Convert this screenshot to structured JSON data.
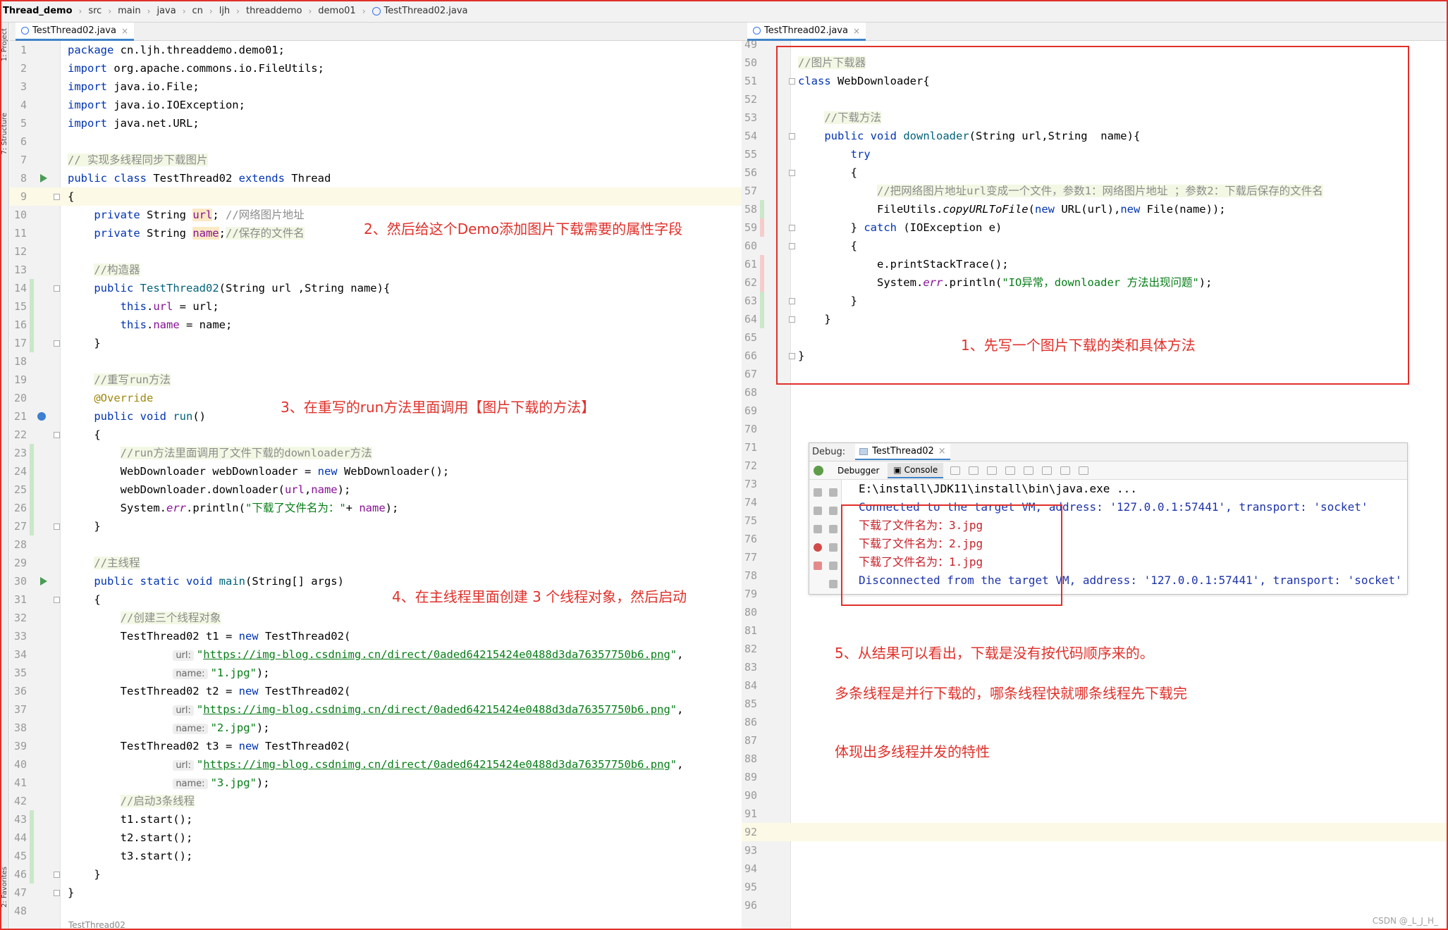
{
  "breadcrumb": [
    "Thread_demo",
    "src",
    "main",
    "java",
    "cn",
    "ljh",
    "threaddemo",
    "demo01",
    "TestThread02.java"
  ],
  "tool_window_labels": [
    "1: Project",
    "7: Structure",
    "2: Favorites"
  ],
  "left_tab": {
    "label": "TestThread02.java",
    "close": "×"
  },
  "right_tab": {
    "label": "TestThread02.java",
    "close": "×"
  },
  "bottom_file_label": "TestThread02",
  "left_lines": [
    {
      "n": "1",
      "html": "<span class=\"kw\">package</span> cn.ljh.threaddemo.demo01;"
    },
    {
      "n": "2",
      "html": "<span class=\"kw\">import</span> org.apache.commons.io.FileUtils;"
    },
    {
      "n": "3",
      "html": "<span class=\"kw\">import</span> java.io.File;"
    },
    {
      "n": "4",
      "html": "<span class=\"kw\">import</span> java.io.IOException;"
    },
    {
      "n": "5",
      "html": "<span class=\"kw\">import</span> java.net.URL;"
    },
    {
      "n": "6",
      "html": ""
    },
    {
      "n": "7",
      "html": "<span class=\"cmh\">// 实现多线程同步下载图片</span>"
    },
    {
      "n": "8",
      "html": "<span class=\"kw\">public class</span> TestThread02 <span class=\"kw\">extends</span> Thread"
    },
    {
      "n": "9",
      "html": "{"
    },
    {
      "n": "10",
      "html": "    <span class=\"kw\">private</span> String <span class=\"fd hl\">url</span>; <span class=\"cm\">//网络图片地址</span>"
    },
    {
      "n": "11",
      "html": "    <span class=\"kw\">private</span> String <span class=\"fd hl\">name</span>;<span class=\"cmh\">//保存的文件名</span>"
    },
    {
      "n": "12",
      "html": ""
    },
    {
      "n": "13",
      "html": "    <span class=\"cmh\">//构造器</span>"
    },
    {
      "n": "14",
      "html": "    <span class=\"kw\">public</span> <span class=\"mt\">TestThread02</span>(String url ,String name){"
    },
    {
      "n": "15",
      "html": "        <span class=\"kw\">this</span>.<span class=\"fd\">url</span> = url;"
    },
    {
      "n": "16",
      "html": "        <span class=\"kw\">this</span>.<span class=\"fd\">name</span> = name;"
    },
    {
      "n": "17",
      "html": "    }"
    },
    {
      "n": "18",
      "html": ""
    },
    {
      "n": "19",
      "html": "    <span class=\"cmh\">//重写run方法</span>"
    },
    {
      "n": "20",
      "html": "    <span class=\"ann\">@Override</span>"
    },
    {
      "n": "21",
      "html": "    <span class=\"kw\">public void</span> <span class=\"mt\">run</span>()"
    },
    {
      "n": "22",
      "html": "    {"
    },
    {
      "n": "23",
      "html": "        <span class=\"cmh\">//run方法里面调用了文件下载的downloader方法</span>"
    },
    {
      "n": "24",
      "html": "        WebDownloader webDownloader = <span class=\"kw\">new</span> WebDownloader();"
    },
    {
      "n": "25",
      "html": "        webDownloader.downloader(<span class=\"fd\">url</span>,<span class=\"fd\">name</span>);"
    },
    {
      "n": "26",
      "html": "        System.<span class=\"fd it\">err</span>.println(<span class=\"st\">\"下载了文件名为：\"</span>+ <span class=\"fd\">name</span>);"
    },
    {
      "n": "27",
      "html": "    }"
    },
    {
      "n": "28",
      "html": ""
    },
    {
      "n": "29",
      "html": "    <span class=\"cmh\">//主线程</span>"
    },
    {
      "n": "30",
      "html": "    <span class=\"kw\">public static void</span> <span class=\"mt\">main</span>(String[] args)"
    },
    {
      "n": "31",
      "html": "    {"
    },
    {
      "n": "32",
      "html": "        <span class=\"cmh\">//创建三个线程对象</span>"
    },
    {
      "n": "33",
      "html": "        TestThread02 t1 = <span class=\"kw\">new</span> TestThread02("
    },
    {
      "n": "34",
      "html": "                <span class=\"hint\">url:</span><span class=\"st\">\"<span class=\"url\">https://img-blog.csdnimg.cn/direct/0aded64215424e0488d3da76357750b6.png</span>\"</span>,"
    },
    {
      "n": "35",
      "html": "                <span class=\"hint\">name:</span><span class=\"st\">\"1.jpg\"</span>);"
    },
    {
      "n": "36",
      "html": "        TestThread02 t2 = <span class=\"kw\">new</span> TestThread02("
    },
    {
      "n": "37",
      "html": "                <span class=\"hint\">url:</span><span class=\"st\">\"<span class=\"url\">https://img-blog.csdnimg.cn/direct/0aded64215424e0488d3da76357750b6.png</span>\"</span>,"
    },
    {
      "n": "38",
      "html": "                <span class=\"hint\">name:</span><span class=\"st\">\"2.jpg\"</span>);"
    },
    {
      "n": "39",
      "html": "        TestThread02 t3 = <span class=\"kw\">new</span> TestThread02("
    },
    {
      "n": "40",
      "html": "                <span class=\"hint\">url:</span><span class=\"st\">\"<span class=\"url\">https://img-blog.csdnimg.cn/direct/0aded64215424e0488d3da76357750b6.png</span>\"</span>,"
    },
    {
      "n": "41",
      "html": "                <span class=\"hint\">name:</span><span class=\"st\">\"3.jpg\"</span>);"
    },
    {
      "n": "42",
      "html": "        <span class=\"cmh\">//启动3条线程</span>"
    },
    {
      "n": "43",
      "html": "        t1.start();"
    },
    {
      "n": "44",
      "html": "        t2.start();"
    },
    {
      "n": "45",
      "html": "        t3.start();"
    },
    {
      "n": "46",
      "html": "    }"
    },
    {
      "n": "47",
      "html": "}"
    },
    {
      "n": "48",
      "html": ""
    }
  ],
  "right_lines": [
    {
      "n": "49",
      "html": ""
    },
    {
      "n": "50",
      "html": "<span class=\"cmh\">//图片下载器</span>"
    },
    {
      "n": "51",
      "html": "<span class=\"kw\">class</span> WebDownloader{"
    },
    {
      "n": "52",
      "html": ""
    },
    {
      "n": "53",
      "html": "    <span class=\"cmh\">//下载方法</span>"
    },
    {
      "n": "54",
      "html": "    <span class=\"kw\">public void</span> <span class=\"mt\">downloader</span>(String url,String  name){"
    },
    {
      "n": "55",
      "html": "        <span class=\"kw\">try</span>"
    },
    {
      "n": "56",
      "html": "        {"
    },
    {
      "n": "57",
      "html": "            <span class=\"cmh\">//把网络图片地址url变成一个文件，参数1：网络图片地址 ；参数2：下载后保存的文件名</span>"
    },
    {
      "n": "58",
      "html": "            FileUtils.<span class=\"it\">copyURLToFile</span>(<span class=\"kw\">new</span> URL(url),<span class=\"kw\">new</span> File(name));"
    },
    {
      "n": "59",
      "html": "        } <span class=\"kw\">catch</span> (IOException e)"
    },
    {
      "n": "60",
      "html": "        {"
    },
    {
      "n": "61",
      "html": "            e.printStackTrace();"
    },
    {
      "n": "62",
      "html": "            System.<span class=\"fd it\">err</span>.println(<span class=\"st\">\"IO异常，downloader 方法出现问题\"</span>);"
    },
    {
      "n": "63",
      "html": "        }"
    },
    {
      "n": "64",
      "html": "    }"
    },
    {
      "n": "65",
      "html": ""
    },
    {
      "n": "66",
      "html": "}"
    },
    {
      "n": "67",
      "html": ""
    },
    {
      "n": "68",
      "html": ""
    },
    {
      "n": "69",
      "html": ""
    },
    {
      "n": "70",
      "html": ""
    },
    {
      "n": "71",
      "html": ""
    },
    {
      "n": "72",
      "html": ""
    },
    {
      "n": "73",
      "html": ""
    },
    {
      "n": "74",
      "html": ""
    },
    {
      "n": "75",
      "html": ""
    },
    {
      "n": "76",
      "html": ""
    },
    {
      "n": "77",
      "html": ""
    },
    {
      "n": "78",
      "html": ""
    },
    {
      "n": "79",
      "html": ""
    },
    {
      "n": "80",
      "html": ""
    },
    {
      "n": "81",
      "html": ""
    },
    {
      "n": "82",
      "html": ""
    },
    {
      "n": "83",
      "html": ""
    },
    {
      "n": "84",
      "html": ""
    },
    {
      "n": "85",
      "html": ""
    },
    {
      "n": "86",
      "html": ""
    },
    {
      "n": "87",
      "html": ""
    },
    {
      "n": "88",
      "html": ""
    },
    {
      "n": "89",
      "html": ""
    },
    {
      "n": "90",
      "html": ""
    },
    {
      "n": "91",
      "html": ""
    },
    {
      "n": "92",
      "html": ""
    },
    {
      "n": "93",
      "html": ""
    },
    {
      "n": "94",
      "html": ""
    },
    {
      "n": "95",
      "html": ""
    },
    {
      "n": "96",
      "html": ""
    }
  ],
  "debug": {
    "label": "Debug:",
    "tab": "TestThread02",
    "tab_close": "×",
    "debugger_tab": "Debugger",
    "console_tab": "Console",
    "console_lines": [
      {
        "text": "E:\\install\\JDK11\\install\\bin\\java.exe ...",
        "color": "black"
      },
      {
        "text": "Connected to the target VM, address: '127.0.0.1:57441', transport: 'socket'",
        "color": "blue"
      },
      {
        "text": "下载了文件名为：3.jpg",
        "color": "red"
      },
      {
        "text": "下载了文件名为：2.jpg",
        "color": "red"
      },
      {
        "text": "下载了文件名为：1.jpg",
        "color": "red"
      },
      {
        "text": "Disconnected from the target VM, address: '127.0.0.1:57441', transport: 'socket'",
        "color": "blue"
      }
    ]
  },
  "notes": {
    "n1": "1、先写一个图片下载的类和具体方法",
    "n2": "2、然后给这个Demo添加图片下载需要的属性字段",
    "n3": "3、在重写的run方法里面调用【图片下载的方法】",
    "n4": "4、在主线程里面创建 3 个线程对象，然后启动",
    "n5": "5、从结果可以看出，下载是没有按代码顺序来的。",
    "n6": "多条线程是并行下载的，哪条线程快就哪条线程先下载完",
    "n7": "体现出多线程并发的特性"
  },
  "watermark": "CSDN @_L_J_H_",
  "colors": {
    "accent_red": "#e0302a",
    "keyword": "#0033b3",
    "string": "#067d17",
    "field": "#871094",
    "console_red": "#c7222a",
    "console_blue": "#1d33aa"
  }
}
